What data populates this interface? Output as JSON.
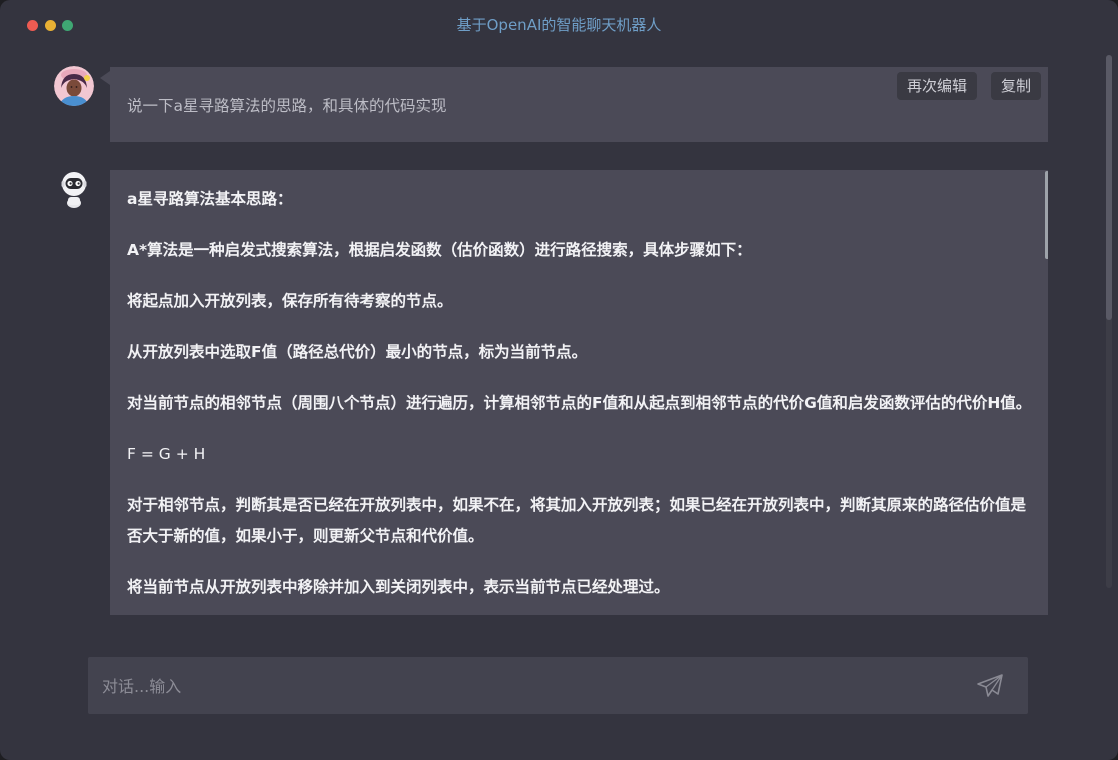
{
  "window": {
    "title": "基于OpenAI的智能聊天机器人"
  },
  "colors": {
    "background": "#34343f",
    "bubble": "#4b4a57",
    "title": "#6f9ec7",
    "close": "#ee5b52",
    "minimize": "#e9b134",
    "zoom": "#3fa773"
  },
  "user_message": {
    "text": "说一下a星寻路算法的思路，和具体的代码实现",
    "edit_label": "再次编辑",
    "copy_label": "复制",
    "avatar_icon": "user-avatar-icon"
  },
  "bot_message": {
    "avatar_icon": "robot-avatar-icon",
    "paragraphs": [
      "a星寻路算法基本思路：",
      "A*算法是一种启发式搜索算法，根据启发函数（估价函数）进行路径搜索，具体步骤如下：",
      "将起点加入开放列表，保存所有待考察的节点。",
      "从开放列表中选取F值（路径总代价）最小的节点，标为当前节点。",
      "对当前节点的相邻节点（周围八个节点）进行遍历，计算相邻节点的F值和从起点到相邻节点的代价G值和启发函数评估的代价H值。",
      "F = G + H",
      "对于相邻节点，判断其是否已经在开放列表中，如果不在，将其加入开放列表；如果已经在开放列表中，判断其原来的路径估价值是否大于新的值，如果小于，则更新父节点和代价值。",
      "将当前节点从开放列表中移除并加入到关闭列表中，表示当前节点已经处理过。"
    ]
  },
  "input": {
    "placeholder": "对话...输入",
    "value": "",
    "send_icon": "send-icon"
  }
}
